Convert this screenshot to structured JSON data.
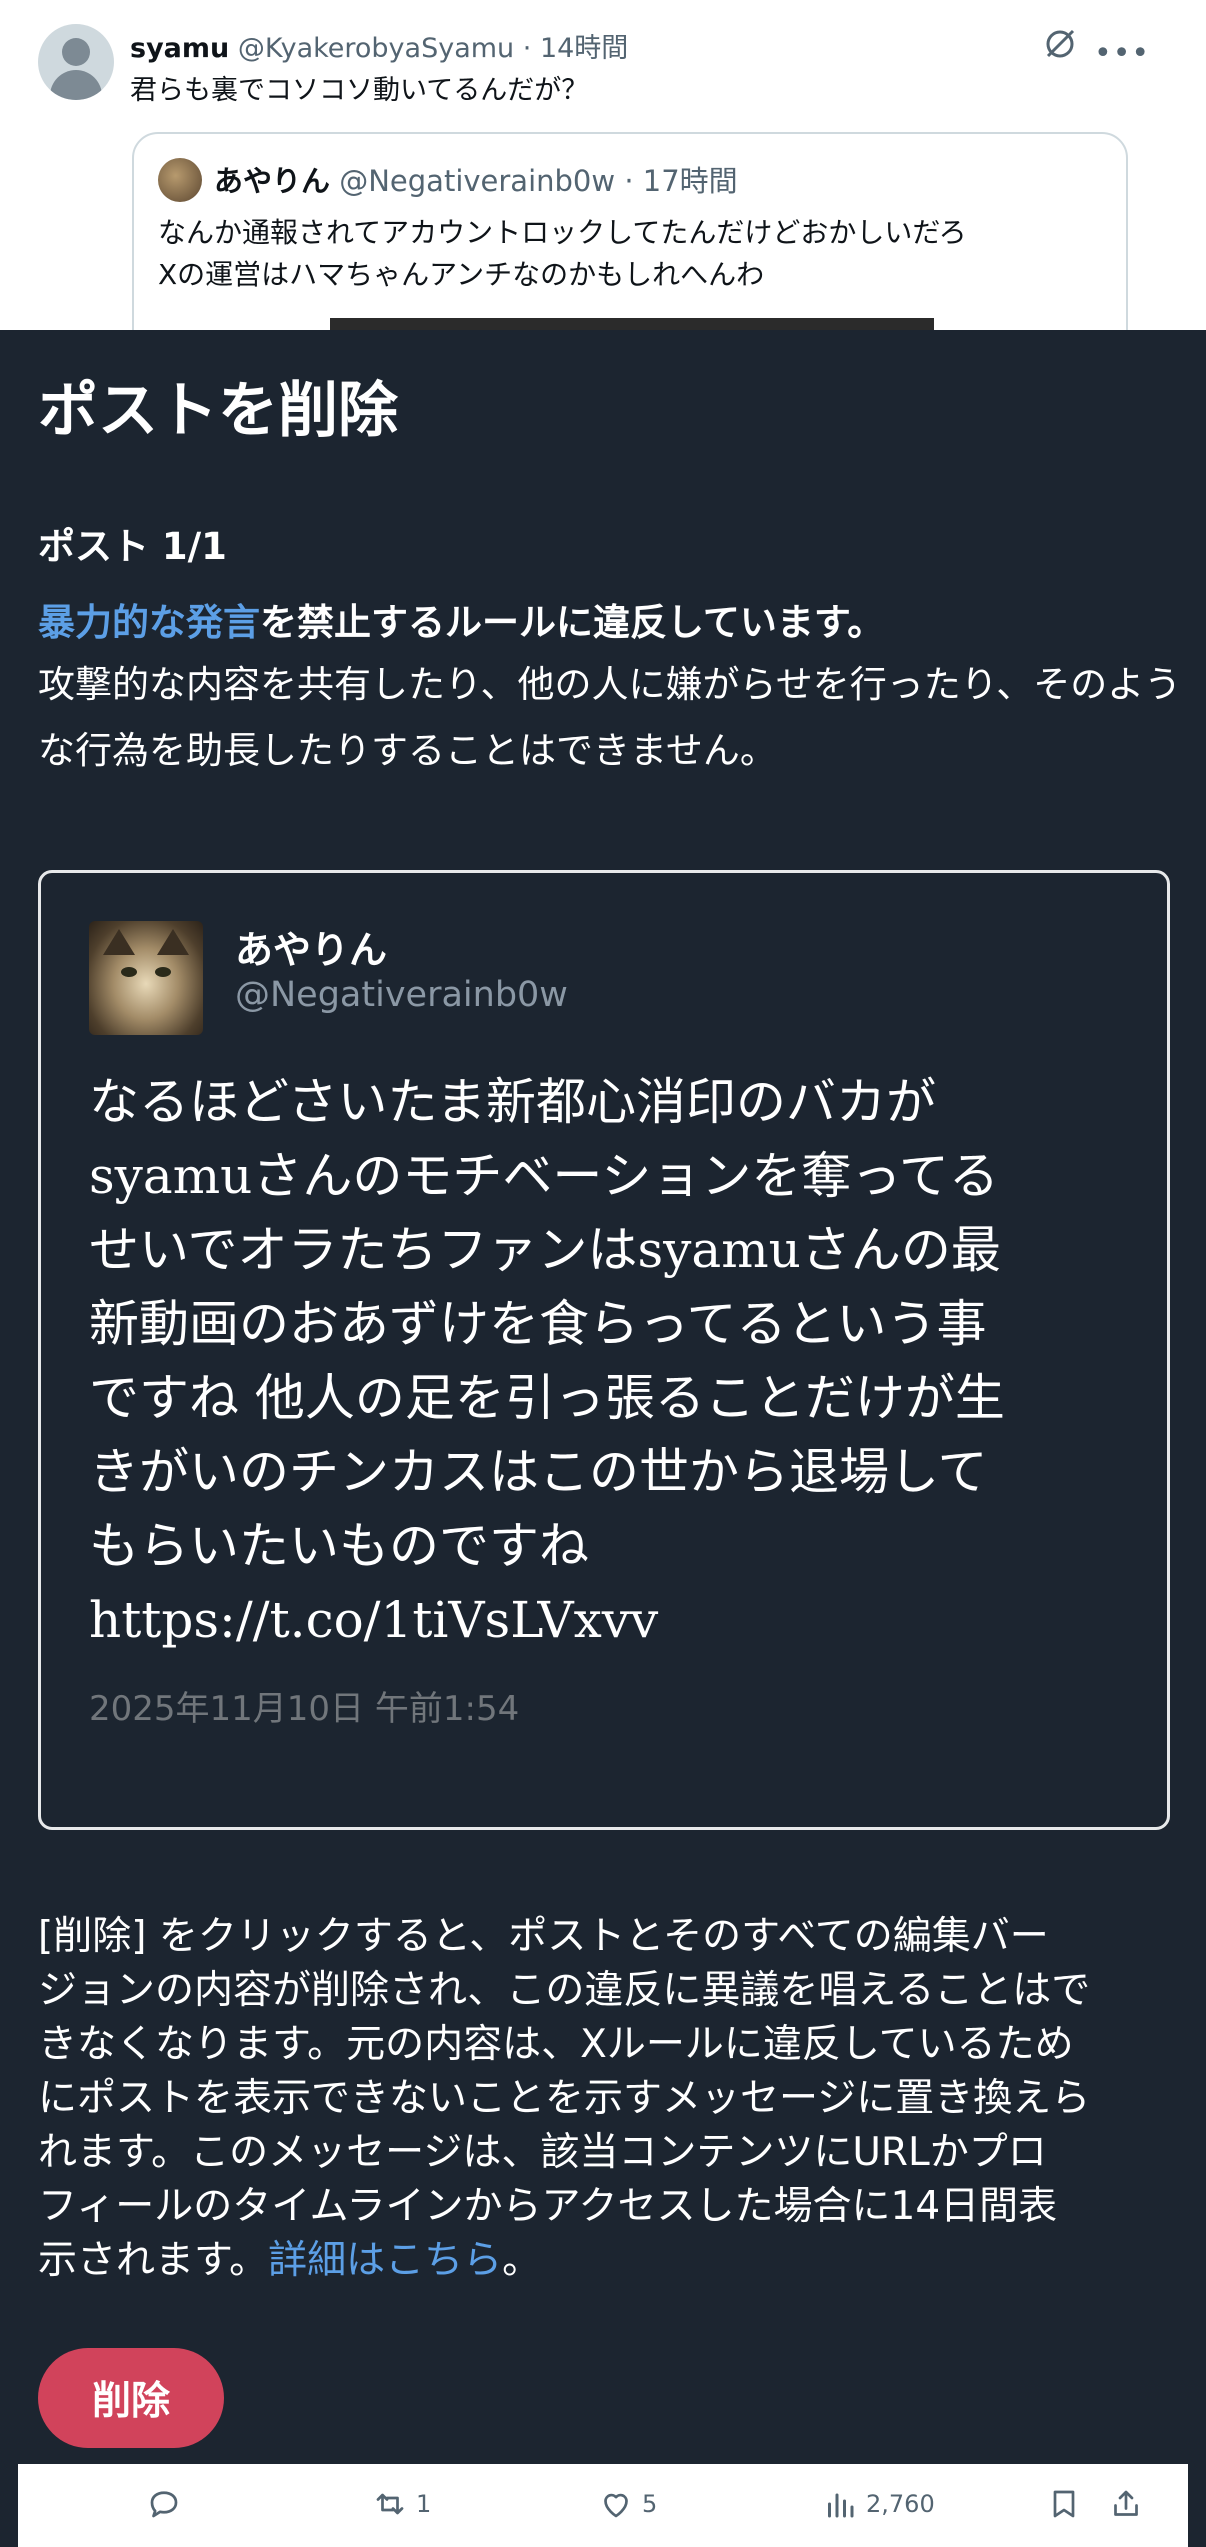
{
  "background_tweet": {
    "author_name": "syamu",
    "author_handle": "@KyakerobyaSyamu",
    "separator": "·",
    "time": "14時間",
    "text": "君らも裏でコソコソ動いてるんだが？",
    "quoted": {
      "author_name": "あやりん",
      "author_handle": "@Negativerainb0w",
      "separator": "·",
      "time": "17時間",
      "lines": [
        "なんか通報されてアカウントロックしてたんだけどおかしいだろ",
        "Xの運営はハマちゃんアンチなのかもしれへんわ"
      ]
    }
  },
  "dialog": {
    "title": "ポストを削除",
    "post_count": "ポスト 1/1",
    "violation_link": "暴力的な発言",
    "violation_rest": "を禁止するルールに違反しています。",
    "explanation": "攻撃的な内容を共有したり、他の人に嫌がらせを行ったり、そのような行為を助長したりすることはできません。",
    "post": {
      "author_name": "あやりん",
      "author_handle": "@Negativerainb0w",
      "lines": [
        "なるほどさいたま新都心消印のバカが",
        "syamuさんのモチベーションを奪ってる",
        "せいでオラたちファンはsyamuさんの最",
        "新動画のおあずけを食らってるという事",
        "ですね 他人の足を引っ張ることだけが生",
        "きがいのチンカスはこの世から退場して",
        "もらいたいものですね",
        "https://t.co/1tiVsLVxvv"
      ],
      "date": "2025年11月10日 午前1:54"
    },
    "notice_lines": [
      "[削除] をクリックすると、ポストとそのすべての編集バー",
      "ジョンの内容が削除され、この違反に異議を唱えることはで",
      "きなくなります。元の内容は、Xルールに違反しているため",
      "にポストを表示できないことを示すメッセージに置き換えら",
      "れます。このメッセージは、該当コンテンツにURLかプロ",
      "フィールのタイムラインからアクセスした場合に14日間表"
    ],
    "notice_last_prefix": "示されます。",
    "notice_link": "詳細はこちら",
    "notice_last_suffix": "。",
    "delete_label": "削除"
  },
  "action_bar": {
    "reply_icon": "reply-icon",
    "repost_count": "1",
    "like_count": "5",
    "views_count": "2,760",
    "bookmark_icon": "bookmark-icon",
    "share_icon": "share-icon"
  },
  "colors": {
    "dialog_bg": "#1c2530",
    "link": "#5c9fe6",
    "delete_button": "#d1435b"
  }
}
